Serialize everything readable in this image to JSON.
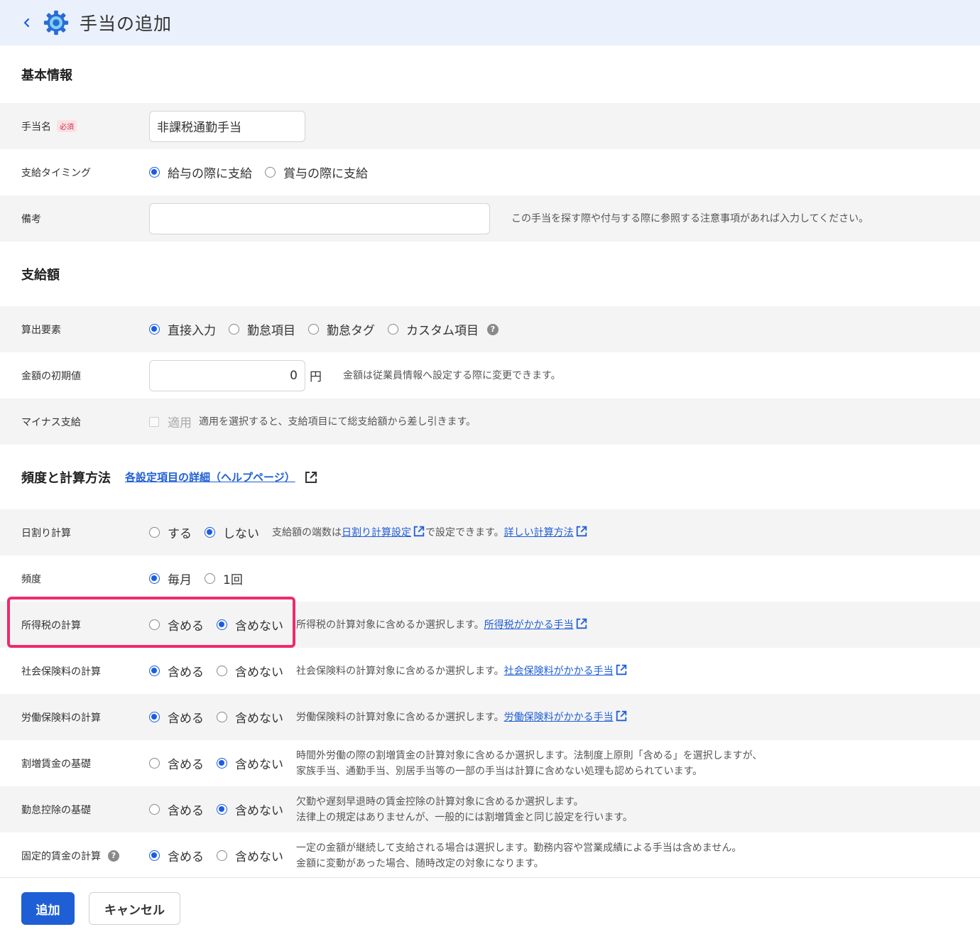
{
  "header": {
    "title": "手当の追加"
  },
  "sections": {
    "basic": "基本情報",
    "amount": "支給額",
    "freq": "頻度と計算方法",
    "help_link": "各設定項目の詳細（ヘルプページ）"
  },
  "fields": {
    "name": {
      "label": "手当名",
      "badge": "必須",
      "value": "非課税通勤手当"
    },
    "timing": {
      "label": "支給タイミング",
      "opt1": "給与の際に支給",
      "opt2": "賞与の際に支給"
    },
    "memo": {
      "label": "備考",
      "value": "",
      "hint": "この手当を探す際や付与する際に参照する注意事項があれば入力してください。"
    },
    "calc_element": {
      "label": "算出要素",
      "opt1": "直接入力",
      "opt2": "勤怠項目",
      "opt3": "勤怠タグ",
      "opt4": "カスタム項目"
    },
    "initial_amount": {
      "label": "金額の初期値",
      "value": "0",
      "unit": "円",
      "hint": "金額は従業員情報へ設定する際に変更できます。"
    },
    "minus": {
      "label": "マイナス支給",
      "check_label": "適用",
      "hint": "適用を選択すると、支給項目にて総支給額から差し引きます。"
    },
    "daily": {
      "label": "日割り計算",
      "opt1": "する",
      "opt2": "しない",
      "hint_pre": "支給額の端数は",
      "link1": "日割り計算設定",
      "hint_mid": "で設定できます。",
      "link2": "詳しい計算方法"
    },
    "frequency": {
      "label": "頻度",
      "opt1": "毎月",
      "opt2": "1回"
    },
    "income_tax": {
      "label": "所得税の計算",
      "opt1": "含める",
      "opt2": "含めない",
      "hint": "所得税の計算対象に含めるか選択します。",
      "link": "所得税がかかる手当"
    },
    "social_ins": {
      "label": "社会保険料の計算",
      "opt1": "含める",
      "opt2": "含めない",
      "hint": "社会保険料の計算対象に含めるか選択します。",
      "link": "社会保険料がかかる手当"
    },
    "labor_ins": {
      "label": "労働保険料の計算",
      "opt1": "含める",
      "opt2": "含めない",
      "hint": "労働保険料の計算対象に含めるか選択します。",
      "link": "労働保険料がかかる手当"
    },
    "overtime": {
      "label": "割増賃金の基礎",
      "opt1": "含める",
      "opt2": "含めない",
      "hint1": "時間外労働の際の割増賃金の計算対象に含めるか選択します。法制度上原則「含める」を選択しますが、",
      "hint2": "家族手当、通勤手当、別居手当等の一部の手当は計算に含めない処理も認められています。"
    },
    "deduction": {
      "label": "勤怠控除の基礎",
      "opt1": "含める",
      "opt2": "含めない",
      "hint1": "欠勤や遅刻早退時の賃金控除の計算対象に含めるか選択します。",
      "hint2": "法律上の規定はありませんが、一般的には割増賃金と同じ設定を行います。"
    },
    "fixed_wage": {
      "label": "固定的賃金の計算",
      "opt1": "含める",
      "opt2": "含めない",
      "hint1": "一定の金額が継続して支給される場合は選択します。勤務内容や営業成績による手当は含めません。",
      "hint2": "金額に変動があった場合、随時改定の対象になります。"
    }
  },
  "buttons": {
    "add": "追加",
    "cancel": "キャンセル"
  },
  "colors": {
    "accent": "#1a5ce5",
    "highlight": "#ee2a6f",
    "header_bg": "#eaf1fc"
  }
}
